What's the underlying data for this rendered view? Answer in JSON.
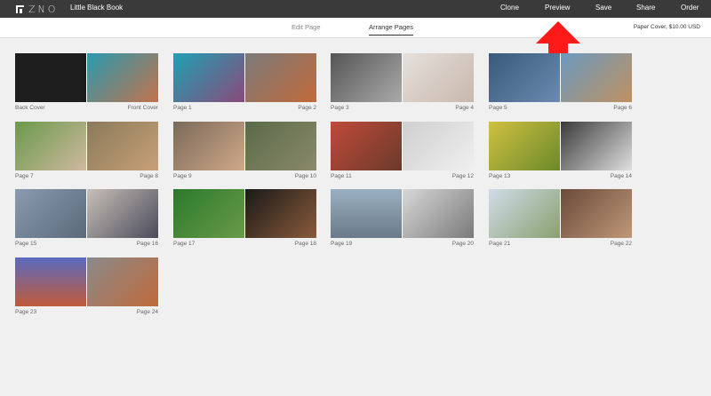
{
  "app": {
    "logo_text": "ZNO",
    "book_title": "Little Black Book"
  },
  "nav": {
    "clone": "Clone",
    "preview": "Preview",
    "save": "Save",
    "share": "Share",
    "order": "Order"
  },
  "tabs": {
    "edit": "Edit Page",
    "arrange": "Arrange Pages"
  },
  "price": "Paper Cover, $10.00 USD",
  "spreads": [
    {
      "left": "Back Cover",
      "right": "Front Cover"
    },
    {
      "left": "Page 1",
      "right": "Page 2"
    },
    {
      "left": "Page 3",
      "right": "Page 4"
    },
    {
      "left": "Page 5",
      "right": "Page 6"
    },
    {
      "left": "Page 7",
      "right": "Page 8"
    },
    {
      "left": "Page 9",
      "right": "Page 10"
    },
    {
      "left": "Page 11",
      "right": "Page 12"
    },
    {
      "left": "Page 13",
      "right": "Page 14"
    },
    {
      "left": "Page 15",
      "right": "Page 16"
    },
    {
      "left": "Page 17",
      "right": "Page 18"
    },
    {
      "left": "Page 19",
      "right": "Page 20"
    },
    {
      "left": "Page 21",
      "right": "Page 22"
    },
    {
      "left": "Page 23",
      "right": "Page 24"
    }
  ],
  "colors": {
    "topbar": "#3a3a3a",
    "arrow": "#ff1a1a",
    "background": "#f0f0f0"
  }
}
